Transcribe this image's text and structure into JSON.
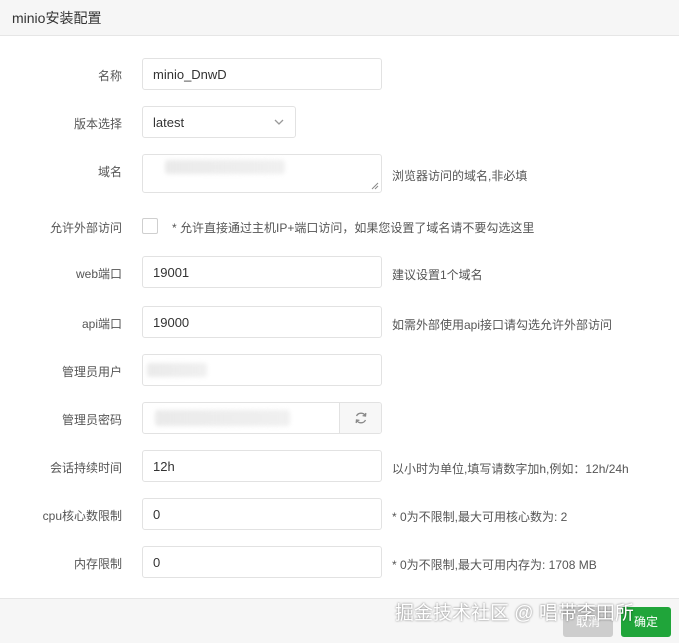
{
  "window": {
    "title": "minio安装配置"
  },
  "form": {
    "name": {
      "label": "名称",
      "value": "minio_DnwD"
    },
    "version": {
      "label": "版本选择",
      "selected": "latest"
    },
    "domain": {
      "label": "域名",
      "hint": "浏览器访问的域名,非必填"
    },
    "external_access": {
      "label": "允许外部访问",
      "checked": false,
      "hint": "* 允许直接通过主机IP+端口访问，如果您设置了域名请不要勾选这里"
    },
    "web_port": {
      "label": "web端口",
      "value": "19001",
      "hint": "建议设置1个域名"
    },
    "api_port": {
      "label": "api端口",
      "value": "19000",
      "hint": "如需外部使用api接口请勾选允许外部访问"
    },
    "admin_user": {
      "label": "管理员用户"
    },
    "admin_password": {
      "label": "管理员密码",
      "refresh_icon": "refresh-icon"
    },
    "session_duration": {
      "label": "会话持续时间",
      "value": "12h",
      "hint": "以小时为单位,填写请数字加h,例如：12h/24h"
    },
    "cpu_limit": {
      "label": "cpu核心数限制",
      "value": "0",
      "hint": "* 0为不限制,最大可用核心数为: 2"
    },
    "memory_limit": {
      "label": "内存限制",
      "value": "0",
      "hint": "* 0为不限制,最大可用内存为: 1708 MB"
    }
  },
  "footer": {
    "cancel_label": "取消",
    "confirm_label": "确定"
  },
  "watermark": "掘金技术社区 @ 唱带李田所",
  "colors": {
    "accent": "#20a53a",
    "border": "#e2e2e2",
    "header_bg": "#f6f6f6"
  }
}
